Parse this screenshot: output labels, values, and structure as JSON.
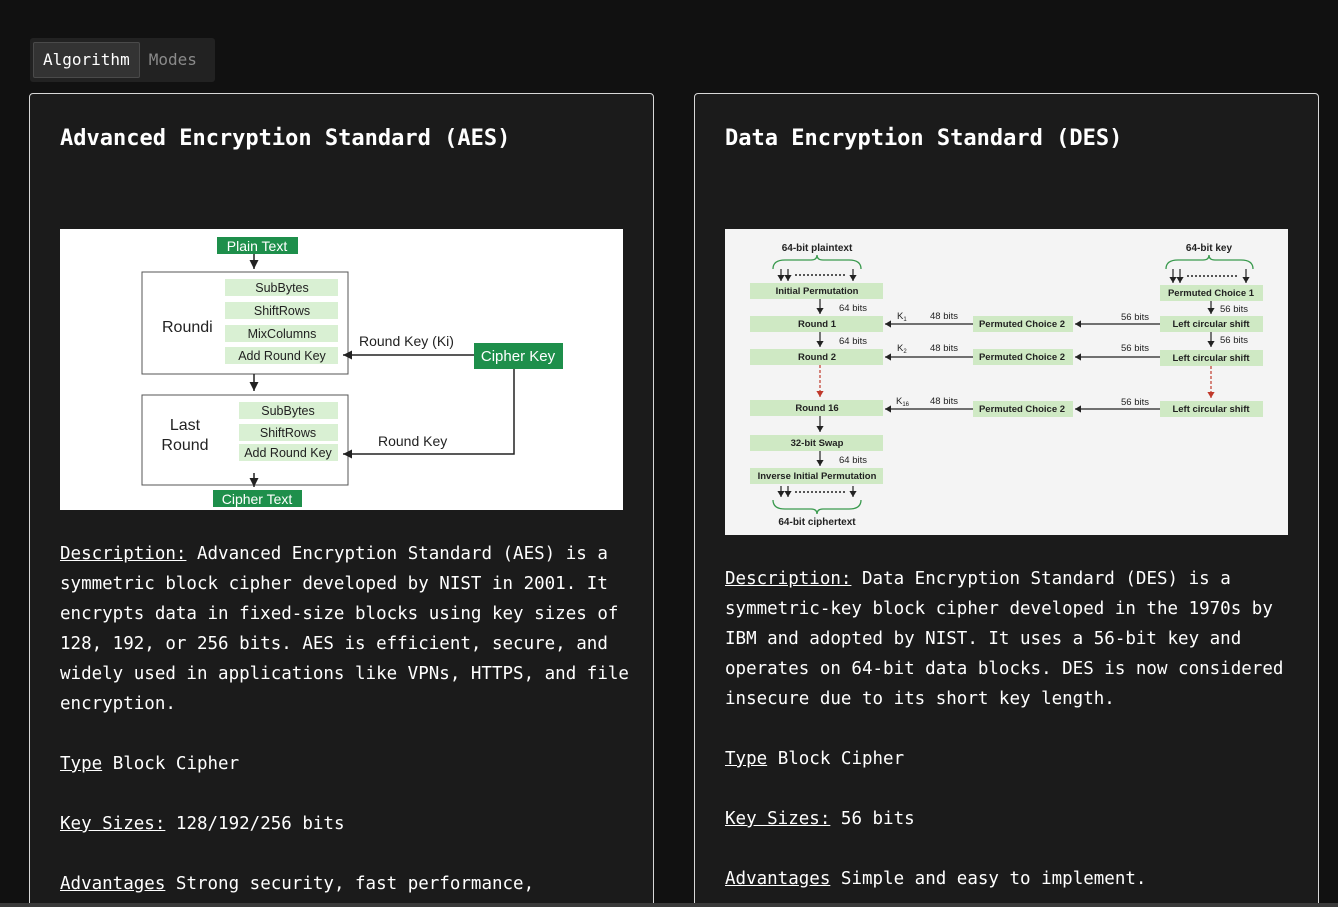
{
  "tabs": [
    {
      "label": "Algorithm",
      "active": true
    },
    {
      "label": "Modes",
      "active": false
    }
  ],
  "aes": {
    "title": "Advanced Encryption Standard (AES)",
    "diagram": {
      "plain_text": "Plain Text",
      "round_i": "Roundi",
      "steps_round": [
        "SubBytes",
        "ShiftRows",
        "MixColumns",
        "Add Round Key"
      ],
      "round_key_ki": "Round Key (Ki)",
      "cipher_key": "Cipher Key",
      "last_round_line1": "Last",
      "last_round_line2": "Round",
      "steps_last": [
        "SubBytes",
        "ShiftRows",
        "Add Round Key"
      ],
      "round_key": "Round Key",
      "cipher_text": "Cipher Text"
    },
    "description_label": "Description:",
    "description": "Advanced Encryption Standard (AES) is a symmetric block cipher developed by NIST in 2001. It encrypts data in fixed-size blocks using key sizes of 128, 192, or 256 bits. AES is efficient, secure, and widely used in applications like VPNs, HTTPS, and file encryption.",
    "type_label": "Type",
    "type_value": "Block Cipher",
    "key_sizes_label": "Key Sizes:",
    "key_sizes_value": "128/192/256 bits",
    "advantages_label": "Advantages",
    "advantages_value": "Strong security, fast performance,"
  },
  "des": {
    "title": "Data Encryption Standard (DES)",
    "diagram": {
      "plaintext": "64-bit plaintext",
      "key": "64-bit key",
      "initial_permutation": "Initial Permutation",
      "permuted_choice_1": "Permuted Choice 1",
      "round1": "Round 1",
      "round2": "Round 2",
      "round16": "Round 16",
      "permuted_choice_2": "Permuted Choice 2",
      "left_circular_shift": "Left circular shift",
      "swap": "32-bit Swap",
      "inverse_permutation": "Inverse Initial Permutation",
      "ciphertext": "64-bit ciphertext",
      "bits64": "64 bits",
      "bits56": "56 bits",
      "bits48": "48 bits",
      "k1": "K",
      "k1_sub": "1",
      "k2": "K",
      "k2_sub": "2",
      "k16": "K",
      "k16_sub": "16"
    },
    "description_label": "Description:",
    "description": "Data Encryption Standard (DES) is a symmetric-key block cipher developed in the 1970s by IBM and adopted by NIST. It uses a 56-bit key and operates on 64-bit data blocks. DES is now considered insecure due to its short key length.",
    "type_label": "Type",
    "type_value": "Block Cipher",
    "key_sizes_label": "Key Sizes:",
    "key_sizes_value": "56 bits",
    "advantages_label": "Advantages",
    "advantages_value": "Simple and easy to implement."
  },
  "colors": {
    "background": "#111111",
    "card": "#1b1b1b",
    "aes_green": "#1e8f4b",
    "aes_light_green": "#d9f0d3",
    "des_light_green": "#cfe9c4"
  }
}
